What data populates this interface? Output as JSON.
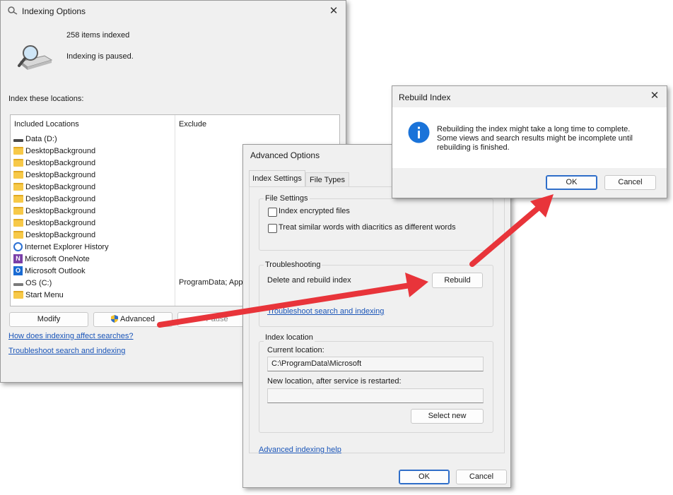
{
  "indexing_options": {
    "title": "Indexing Options",
    "items_indexed": "258 items indexed",
    "status": "Indexing is paused.",
    "index_these_locations": "Index these locations:",
    "col_included": "Included Locations",
    "col_exclude": "Exclude",
    "locations": [
      {
        "name": "Data (D:)",
        "icon": "drive-icon",
        "exclude": ""
      },
      {
        "name": "DesktopBackground",
        "icon": "folder-icon",
        "exclude": ""
      },
      {
        "name": "DesktopBackground",
        "icon": "folder-icon",
        "exclude": ""
      },
      {
        "name": "DesktopBackground",
        "icon": "folder-icon",
        "exclude": ""
      },
      {
        "name": "DesktopBackground",
        "icon": "folder-icon",
        "exclude": ""
      },
      {
        "name": "DesktopBackground",
        "icon": "folder-icon",
        "exclude": ""
      },
      {
        "name": "DesktopBackground",
        "icon": "folder-icon",
        "exclude": ""
      },
      {
        "name": "DesktopBackground",
        "icon": "folder-icon",
        "exclude": ""
      },
      {
        "name": "DesktopBackground",
        "icon": "folder-icon",
        "exclude": ""
      },
      {
        "name": "Internet Explorer History",
        "icon": "internet-explorer-icon",
        "exclude": ""
      },
      {
        "name": "Microsoft OneNote",
        "icon": "onenote-icon",
        "exclude": ""
      },
      {
        "name": "Microsoft Outlook",
        "icon": "outlook-icon",
        "exclude": ""
      },
      {
        "name": "OS (C:)",
        "icon": "os-drive-icon",
        "exclude": "ProgramData; Appl"
      },
      {
        "name": "Start Menu",
        "icon": "folder-icon",
        "exclude": ""
      }
    ],
    "modify_label": "Modify",
    "advanced_label": "Advanced",
    "pause_label": "Pause",
    "link_how": "How does indexing affect searches?",
    "link_troubleshoot": "Troubleshoot search and indexing"
  },
  "advanced_options": {
    "title": "Advanced Options",
    "tab_index_settings": "Index Settings",
    "tab_file_types": "File Types",
    "file_settings_label": "File Settings",
    "chk_encrypted": "Index encrypted files",
    "chk_diacritics": "Treat similar words with diacritics as different words",
    "troubleshooting_label": "Troubleshooting",
    "delete_rebuild": "Delete and rebuild index",
    "rebuild_label": "Rebuild",
    "troubleshoot_link": "Troubleshoot search and indexing",
    "index_location_label": "Index location",
    "current_location_label": "Current location:",
    "current_location_value": "C:\\ProgramData\\Microsoft",
    "new_location_label": "New location, after service is restarted:",
    "new_location_value": "",
    "select_new_label": "Select new",
    "advanced_help_link": "Advanced indexing help",
    "ok_label": "OK",
    "cancel_label": "Cancel"
  },
  "rebuild_index": {
    "title": "Rebuild Index",
    "message_line1": "Rebuilding the index might take a long time to complete.",
    "message_line2": "Some views and search results might be incomplete until",
    "message_line3": "rebuilding is finished.",
    "ok_label": "OK",
    "cancel_label": "Cancel"
  },
  "colors": {
    "accent_blue": "#2f6ec9",
    "link_blue": "#1a55b8",
    "arrow_red": "#e8343a",
    "info_blue": "#1a73d9"
  }
}
